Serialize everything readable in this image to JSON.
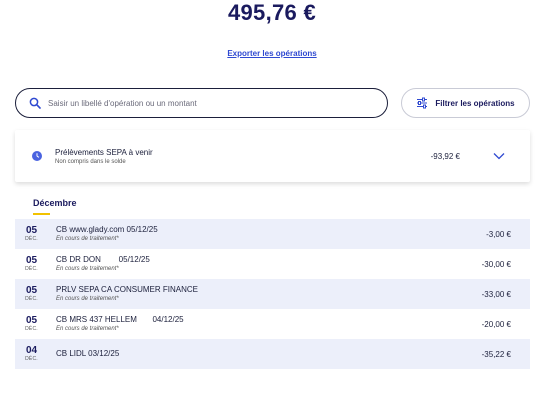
{
  "balance": "495,76 €",
  "export_label": "Exporter les opérations",
  "search": {
    "placeholder": "Saisir un libellé d'opération ou un montant",
    "value": ""
  },
  "filter_label": "Filtrer les opérations",
  "pending": {
    "title": "Prélèvements SEPA à venir",
    "subtitle": "Non compris dans le solde",
    "amount": "-93,92 €"
  },
  "month_label": "Décembre",
  "operations": [
    {
      "day": "05",
      "month": "DÉC.",
      "label": "CB www.glady.com 05/12/25",
      "status": "En cours de traitement*",
      "amount": "-3,00 €"
    },
    {
      "day": "05",
      "month": "DÉC.",
      "label": "CB DR DON        05/12/25",
      "status": "En cours de traitement*",
      "amount": "-30,00 €"
    },
    {
      "day": "05",
      "month": "DÉC.",
      "label": "PRLV SEPA CA CONSUMER FINANCE",
      "status": "En cours de traitement*",
      "amount": "-33,00 €"
    },
    {
      "day": "05",
      "month": "DÉC.",
      "label": "CB MRS 437 HELLEM       04/12/25",
      "status": "En cours de traitement*",
      "amount": "-20,00 €"
    },
    {
      "day": "04",
      "month": "DÉC.",
      "label": "CB LIDL 03/12/25",
      "status": "",
      "amount": "-35,22 €"
    }
  ],
  "colors": {
    "accent": "#2f49d1",
    "navy": "#1a1a5e",
    "month_underline": "#f2c200",
    "row_shade": "#eceffa"
  }
}
